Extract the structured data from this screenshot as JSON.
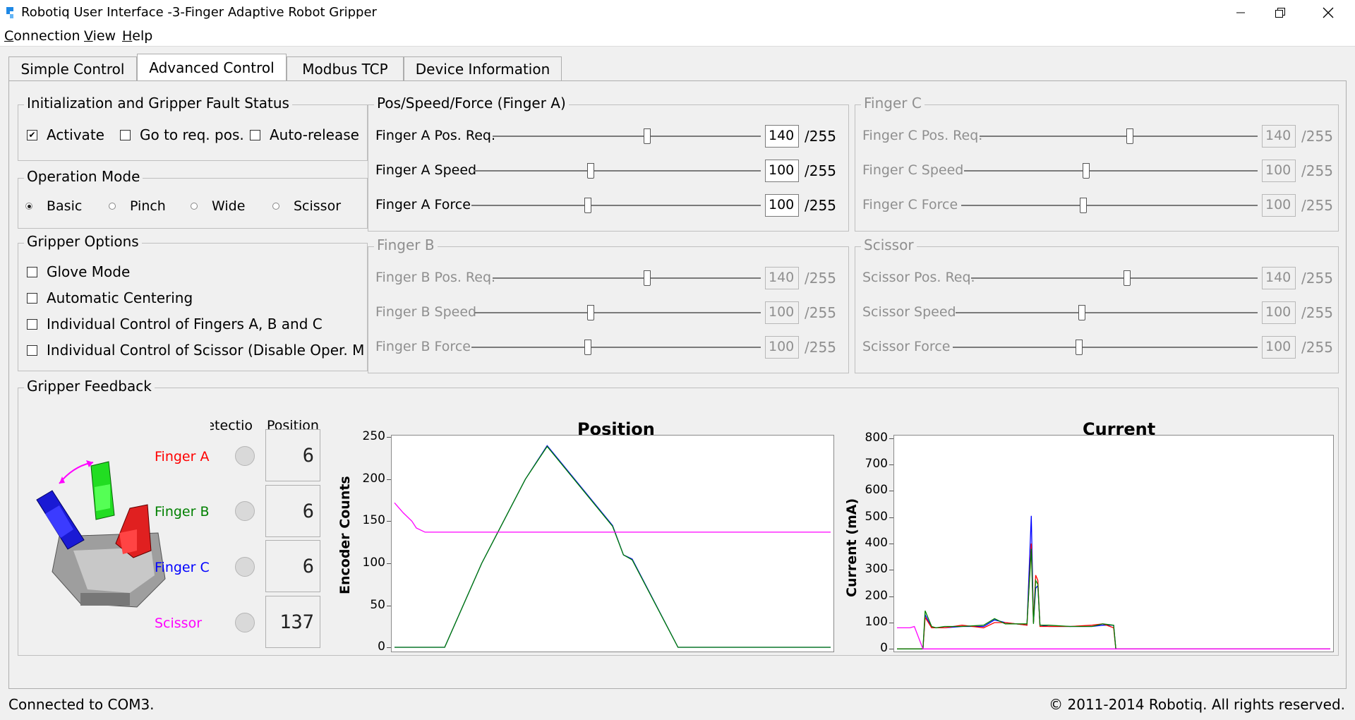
{
  "window": {
    "title": "Robotiq User Interface -3-Finger Adaptive Robot Gripper"
  },
  "menu": {
    "items": [
      "Connection",
      "View",
      "Help"
    ]
  },
  "tabs": [
    "Simple Control",
    "Advanced Control",
    "Modbus TCP",
    "Device Information"
  ],
  "active_tab": "Advanced Control",
  "init_group": {
    "title": "Initialization and Gripper Fault Status",
    "activate": {
      "label": "Activate",
      "checked": true
    },
    "go_to_req_pos": {
      "label": "Go to req. pos.",
      "checked": false
    },
    "auto_release": {
      "label": "Auto-release",
      "checked": false
    }
  },
  "operation_mode": {
    "title": "Operation Mode",
    "options": [
      "Basic",
      "Pinch",
      "Wide",
      "Scissor"
    ],
    "selected": "Basic"
  },
  "gripper_options": {
    "title": "Gripper Options",
    "items": [
      "Glove Mode",
      "Automatic Centering",
      "Individual Control of Fingers A, B and C",
      "Individual Control of Scissor (Disable Oper. M"
    ]
  },
  "finger_a": {
    "title": "Pos/Speed/Force (Finger A)",
    "rows": [
      {
        "label": "Finger A Pos. Req.",
        "value": "140",
        "unit": "/255"
      },
      {
        "label": "Finger A Speed",
        "value": "100",
        "unit": "/255"
      },
      {
        "label": "Finger A Force",
        "value": "100",
        "unit": "/255"
      }
    ]
  },
  "finger_b": {
    "title": "Finger B",
    "rows": [
      {
        "label": "Finger B Pos. Req.",
        "value": "140",
        "unit": "/255"
      },
      {
        "label": "Finger B Speed",
        "value": "100",
        "unit": "/255"
      },
      {
        "label": "Finger B Force",
        "value": "100",
        "unit": "/255"
      }
    ]
  },
  "finger_c": {
    "title": "Finger C",
    "rows": [
      {
        "label": "Finger C Pos. Req.",
        "value": "140",
        "unit": "/255"
      },
      {
        "label": "Finger C Speed",
        "value": "100",
        "unit": "/255"
      },
      {
        "label": "Finger C Force",
        "value": "100",
        "unit": "/255"
      }
    ]
  },
  "scissor": {
    "title": "Scissor",
    "rows": [
      {
        "label": "Scissor Pos. Req.",
        "value": "140",
        "unit": "/255"
      },
      {
        "label": "Scissor Speed",
        "value": "100",
        "unit": "/255"
      },
      {
        "label": "Scissor Force",
        "value": "100",
        "unit": "/255"
      }
    ]
  },
  "feedback": {
    "title": "Gripper Feedback",
    "col_detection": "etectio",
    "col_position": "Position",
    "rows": [
      {
        "label": "Finger A",
        "color": "#ff0000",
        "position": "6"
      },
      {
        "label": "Finger B",
        "color": "#008000",
        "position": "6"
      },
      {
        "label": "Finger C",
        "color": "#0000ff",
        "position": "6"
      },
      {
        "label": "Scissor",
        "color": "#ff00ff",
        "position": "137"
      }
    ]
  },
  "chart_data": [
    {
      "type": "line",
      "title": "Position",
      "xlabel": "",
      "ylabel": "Encoder Counts",
      "ylim": [
        -5,
        252
      ],
      "yticks": [
        0,
        50,
        100,
        150,
        200,
        250
      ],
      "x": [
        0,
        4,
        8,
        10,
        14,
        19,
        23,
        40,
        60,
        70,
        100,
        105,
        109,
        130,
        152,
        180,
        200
      ],
      "series": [
        {
          "color": "#0000ff",
          "values": [
            0,
            0,
            0,
            0,
            0,
            0,
            0,
            100,
            200,
            240,
            145,
            110,
            105,
            0,
            0,
            0,
            0
          ]
        },
        {
          "color": "#008000",
          "values": [
            0,
            0,
            0,
            0,
            0,
            0,
            0,
            100,
            200,
            239,
            144,
            110,
            104,
            0,
            0,
            0,
            0
          ]
        },
        {
          "color": "#ff00ff",
          "values": [
            172,
            160,
            150,
            142,
            137,
            137,
            137,
            137,
            137,
            137,
            137,
            137,
            137,
            137,
            137,
            137,
            137
          ]
        }
      ]
    },
    {
      "type": "line",
      "title": "Current",
      "xlabel": "",
      "ylabel": "Current (mA)",
      "ylim": [
        -10,
        810
      ],
      "yticks": [
        0,
        100,
        200,
        300,
        400,
        500,
        600,
        700,
        800
      ],
      "x": [
        0,
        6,
        8,
        12,
        13,
        16,
        18,
        22,
        30,
        40,
        45,
        50,
        60,
        62,
        63,
        64,
        65,
        66,
        70,
        80,
        90,
        95,
        100,
        101,
        110,
        200
      ],
      "series": [
        {
          "color": "#0000ff",
          "values": [
            0,
            0,
            0,
            0,
            130,
            80,
            80,
            80,
            85,
            85,
            110,
            100,
            90,
            505,
            100,
            230,
            240,
            90,
            85,
            85,
            85,
            90,
            90,
            0,
            0,
            0
          ]
        },
        {
          "color": "#ff0000",
          "values": [
            0,
            0,
            0,
            0,
            120,
            80,
            80,
            80,
            90,
            80,
            100,
            100,
            90,
            400,
            100,
            280,
            260,
            85,
            85,
            85,
            90,
            95,
            80,
            0,
            0,
            0
          ]
        },
        {
          "color": "#008000",
          "values": [
            0,
            0,
            0,
            0,
            145,
            85,
            80,
            85,
            85,
            90,
            115,
            95,
            95,
            380,
            95,
            260,
            245,
            90,
            90,
            85,
            85,
            95,
            90,
            0,
            0,
            0
          ]
        },
        {
          "color": "#ff00ff",
          "values": [
            80,
            80,
            85,
            0,
            0,
            0,
            0,
            0,
            0,
            0,
            0,
            0,
            0,
            0,
            0,
            0,
            0,
            0,
            0,
            0,
            0,
            0,
            0,
            0,
            0,
            0
          ]
        }
      ]
    }
  ],
  "status": {
    "left": "Connected to COM3.",
    "right": "© 2011-2014 Robotiq. All rights reserved."
  }
}
